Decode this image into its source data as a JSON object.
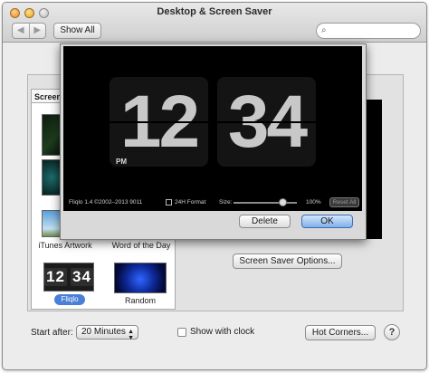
{
  "window": {
    "title": "Desktop & Screen Saver"
  },
  "toolbar": {
    "back": "◀",
    "forward": "▶",
    "show_all": "Show All",
    "search_placeholder": ""
  },
  "source_list": {
    "tab_label": "Screen",
    "items": [
      {
        "label": "iTunes Artwork"
      },
      {
        "label": "Word of the Day"
      },
      {
        "label": "Fliqlo",
        "thumb_text": [
          "12",
          "34"
        ],
        "selected": true
      },
      {
        "label": "Random"
      }
    ]
  },
  "screen_saver_options_label": "Screen Saver Options...",
  "fliqlo_sheet": {
    "hours": "12",
    "minutes": "34",
    "ampm": "PM",
    "credit": "Fliqlo 1.4 ©2002–2013 9011",
    "format_label": "24H Format",
    "size_label": "Size:",
    "size_value": "100%",
    "size_fraction": 0.72,
    "reset_label": "Reset All",
    "delete_label": "Delete",
    "ok_label": "OK"
  },
  "bottom": {
    "start_after_label": "Start after:",
    "start_after_value": "20 Minutes",
    "show_clock_label": "Show with clock",
    "hot_corners_label": "Hot Corners...",
    "help_label": "?"
  },
  "colors": {
    "accent": "#4a7fd6",
    "ok_button": "#7fb0ea",
    "preview_bg": "#000000"
  }
}
